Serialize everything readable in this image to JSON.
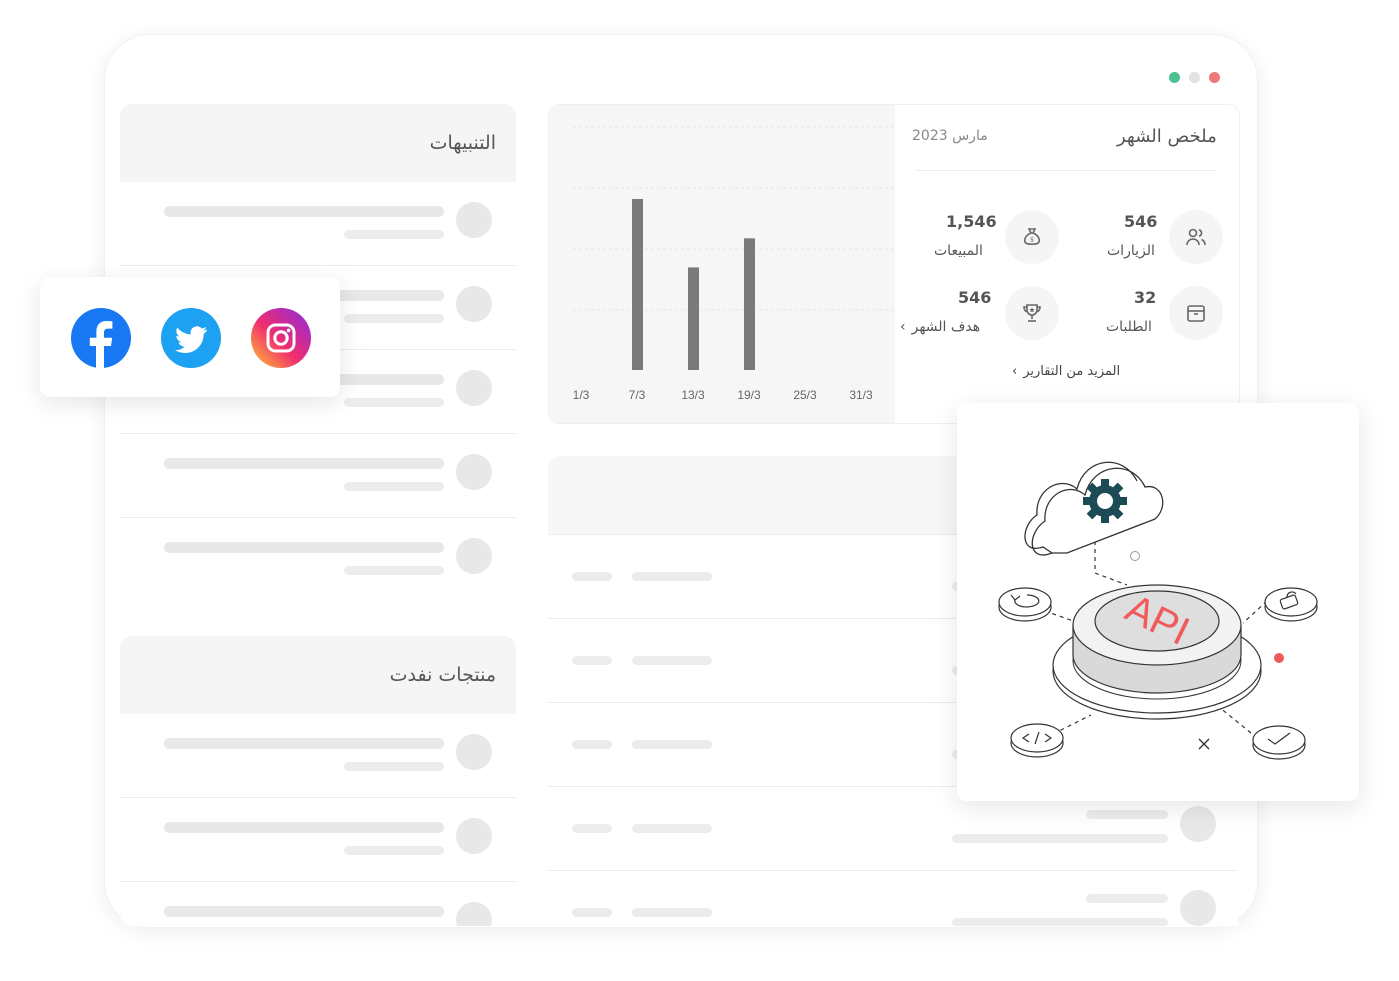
{
  "window": {
    "dots": [
      "#4cc18f",
      "#e2e2e2",
      "#ef7878"
    ]
  },
  "alerts_panel": {
    "title": "التنبيهات"
  },
  "out_of_stock_panel": {
    "title": "منتجات نفدت"
  },
  "summary": {
    "title": "ملخص الشهر",
    "period": "مارس 2023",
    "stats": [
      {
        "value": "546",
        "label": "الزيارات",
        "icon": "users-icon"
      },
      {
        "value": "1,546",
        "label": "المبيعات",
        "icon": "money-bag-icon"
      },
      {
        "value": "32",
        "label": "الطلبات",
        "icon": "box-icon"
      },
      {
        "value": "546",
        "label": "هدف الشهر",
        "icon": "trophy-icon"
      }
    ],
    "more_reports": "المزيد من التقارير"
  },
  "chart_data": {
    "type": "bar",
    "x_ticks": [
      "1/3",
      "7/3",
      "13/3",
      "19/3",
      "25/3",
      "31/3"
    ],
    "categories": [
      "7/3",
      "13/3",
      "19/3"
    ],
    "values": [
      100,
      60,
      77
    ],
    "ylim": [
      0,
      100
    ],
    "grid": true,
    "color": "#7a7a7a"
  },
  "social": {
    "icons": [
      "facebook-icon",
      "twitter-icon",
      "instagram-icon"
    ]
  },
  "api_illustration": {
    "label": "API",
    "accent": "#f05a5a",
    "gear_color": "#1c4a55"
  }
}
